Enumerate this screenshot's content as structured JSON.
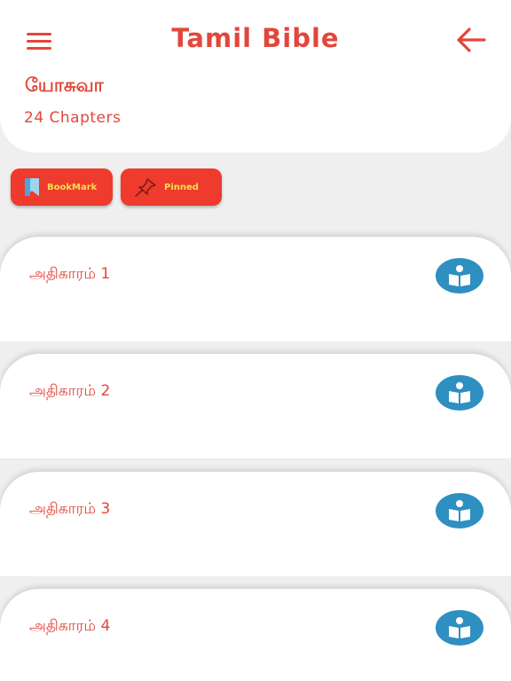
{
  "header": {
    "title": "Tamil Bible"
  },
  "book": {
    "name": "யோசுவா",
    "chapter_count": "24 Chapters"
  },
  "actions": {
    "bookmark_label": "BookMark",
    "pinned_label": "Pinned"
  },
  "chapters": [
    {
      "label": "அதிகாரம் 1"
    },
    {
      "label": "அதிகாரம் 2"
    },
    {
      "label": "அதிகாரம் 3"
    },
    {
      "label": "அதிகாரம் 4"
    }
  ],
  "colors": {
    "accent": "#e2473b",
    "pill": "#ee3b2d",
    "pill_text": "#f5e04a",
    "read_button": "#2e8fc1",
    "background": "#efefef"
  },
  "icons": {
    "menu": "hamburger-menu-icon",
    "back": "arrow-left-icon",
    "bookmark": "bookmark-icon",
    "pinned": "pushpin-icon",
    "read": "reader-book-icon"
  }
}
